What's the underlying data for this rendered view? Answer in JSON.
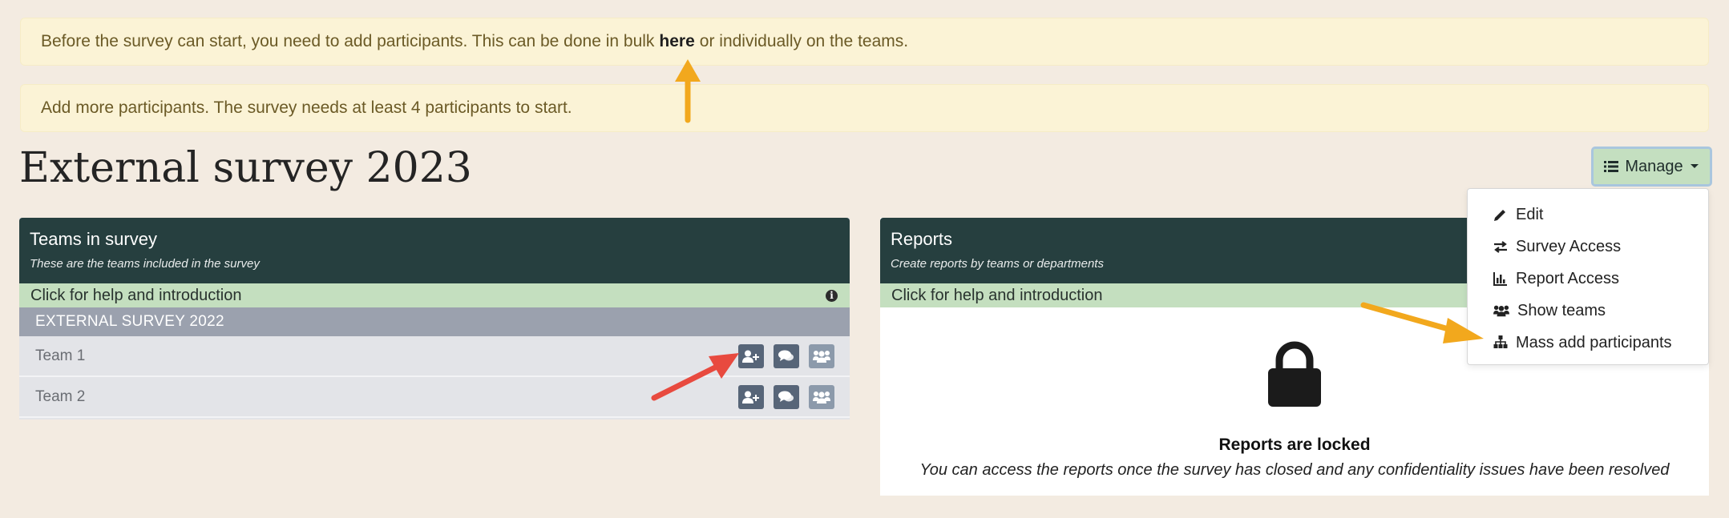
{
  "alerts": {
    "first_before": "Before the survey can start, you need to add participants. This can be done in bulk",
    "first_link": "here",
    "first_after": "or individually on the teams.",
    "second": "Add more participants. The survey needs at least 4 participants to start."
  },
  "page_title": "External survey 2023",
  "manage": {
    "label": "Manage",
    "items": [
      {
        "label": "Edit",
        "icon": "pencil-icon"
      },
      {
        "label": "Survey Access",
        "icon": "exchange-icon"
      },
      {
        "label": "Report Access",
        "icon": "bar-chart-icon"
      },
      {
        "label": "Show teams",
        "icon": "users-icon"
      },
      {
        "label": "Mass add participants",
        "icon": "sitemap-icon"
      }
    ]
  },
  "teams_panel": {
    "title": "Teams in survey",
    "subtitle": "These are the teams included in the survey",
    "help": "Click for help and introduction",
    "group": "EXTERNAL SURVEY 2022",
    "teams": [
      {
        "name": "Team 1"
      },
      {
        "name": "Team 2"
      }
    ]
  },
  "reports_panel": {
    "title": "Reports",
    "subtitle": "Create reports by teams or departments",
    "help": "Click for help and introduction",
    "locked_title": "Reports are locked",
    "locked_text": "You can access the reports once the survey has closed and any confidentiality issues have been resolved"
  },
  "colors": {
    "background": "#f3ebe1",
    "panel_header": "#263f3f",
    "help_bar": "#c4dfbf",
    "alert": "#fbf3d6",
    "annotation_yellow": "#f2a81d",
    "annotation_red": "#e84a3f"
  }
}
